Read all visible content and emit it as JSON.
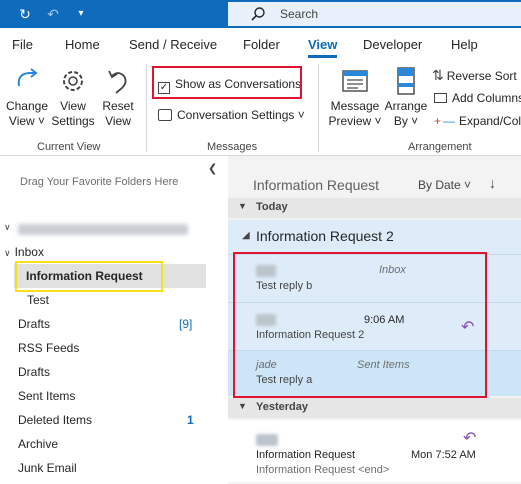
{
  "search": {
    "label": "Search"
  },
  "tabs": [
    "File",
    "Home",
    "Send / Receive",
    "Folder",
    "View",
    "Developer",
    "Help"
  ],
  "ribbon": {
    "change_view": [
      "Change",
      "View ˅"
    ],
    "view_settings": [
      "View",
      "Settings"
    ],
    "reset_view": [
      "Reset",
      "View"
    ],
    "current_view_group": "Current View",
    "show_as_conversations": "Show as Conversations",
    "conversation_settings": "Conversation Settings ˅",
    "messages_group": "Messages",
    "message_preview": [
      "Message",
      "Preview ˅"
    ],
    "arrange_by": [
      "Arrange",
      "By ˅"
    ],
    "reverse_sort": "Reverse Sort",
    "add_columns": "Add Columns",
    "expand_collapse": "Expand/Colla",
    "arrangement_group": "Arrangement"
  },
  "left": {
    "drag_hint": "Drag Your Favorite Folders Here",
    "inbox": "Inbox",
    "folders": [
      {
        "label": "Information Request"
      },
      {
        "label": "Test"
      },
      {
        "label": "Drafts",
        "count": "[9]"
      },
      {
        "label": "RSS Feeds"
      },
      {
        "label": "Drafts"
      },
      {
        "label": "Sent Items"
      },
      {
        "label": "Deleted Items",
        "count": "1"
      },
      {
        "label": "Archive"
      },
      {
        "label": "Junk Email"
      }
    ]
  },
  "right": {
    "title": "Information Request",
    "sort": "By Date ˅",
    "sort_arrow": "↓",
    "today": "Today",
    "conversation": "Information Request 2",
    "messages": [
      {
        "folder": "Inbox",
        "body": "Test reply b"
      },
      {
        "time": "9:06 AM",
        "body": "Information Request 2"
      },
      {
        "sender": "jade",
        "folder": "Sent Items",
        "body": "Test reply a"
      }
    ],
    "yesterday": "Yesterday",
    "y_message": {
      "subject": "Information Request",
      "time": "Mon 7:52 AM",
      "preview": "Information Request <end>"
    }
  },
  "colors": {
    "accent": "#0f6cbd",
    "highlight_red": "#e0142c",
    "highlight_yellow": "#f5e01a"
  }
}
